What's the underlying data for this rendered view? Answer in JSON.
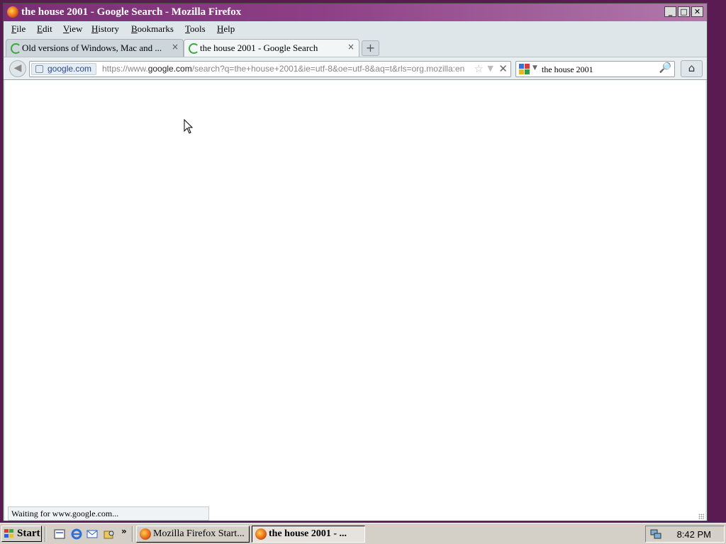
{
  "window": {
    "title": "the house 2001 - Google Search - Mozilla Firefox",
    "controls": [
      "_",
      "□",
      "✕"
    ]
  },
  "menu": {
    "items": [
      {
        "label": "File",
        "u": "F",
        "rest": "ile"
      },
      {
        "label": "Edit",
        "u": "E",
        "rest": "dit"
      },
      {
        "label": "View",
        "u": "V",
        "rest": "iew"
      },
      {
        "label": "History",
        "u": "H",
        "rest": "istory"
      },
      {
        "label": "Bookmarks",
        "u": "B",
        "rest": "ookmarks"
      },
      {
        "label": "Tools",
        "u": "T",
        "rest": "ools"
      },
      {
        "label": "Help",
        "u": "H",
        "rest": "elp"
      }
    ]
  },
  "tabs": [
    {
      "label": "Old versions of Windows, Mac and ...",
      "close": "×",
      "active": false
    },
    {
      "label": "the house 2001 - Google Search",
      "close": "×",
      "active": true
    }
  ],
  "newtab": "+",
  "nav": {
    "site_identity": "google.com",
    "url_prefix": "https://www.",
    "url_domain": "google.com",
    "url_rest": "/search?q=the+house+2001&ie=utf-8&oe=utf-8&aq=t&rls=org.mozilla:en",
    "search_query": "the house 2001"
  },
  "status": {
    "text": "Waiting for www.google.com..."
  },
  "taskbar": {
    "start_label": "Start",
    "more": "»",
    "tasks": [
      {
        "label": "Mozilla Firefox Start...",
        "active": false
      },
      {
        "label": "the house 2001 - ...",
        "active": true
      }
    ],
    "clock": "8:42 PM"
  }
}
